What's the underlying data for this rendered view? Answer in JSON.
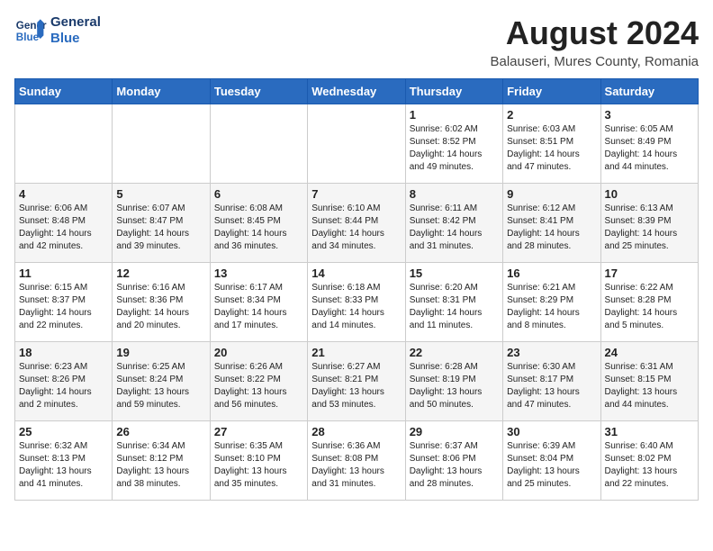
{
  "header": {
    "logo_line1": "General",
    "logo_line2": "Blue",
    "month_year": "August 2024",
    "location": "Balauseri, Mures County, Romania"
  },
  "weekdays": [
    "Sunday",
    "Monday",
    "Tuesday",
    "Wednesday",
    "Thursday",
    "Friday",
    "Saturday"
  ],
  "weeks": [
    [
      {
        "day": "",
        "info": ""
      },
      {
        "day": "",
        "info": ""
      },
      {
        "day": "",
        "info": ""
      },
      {
        "day": "",
        "info": ""
      },
      {
        "day": "1",
        "info": "Sunrise: 6:02 AM\nSunset: 8:52 PM\nDaylight: 14 hours\nand 49 minutes."
      },
      {
        "day": "2",
        "info": "Sunrise: 6:03 AM\nSunset: 8:51 PM\nDaylight: 14 hours\nand 47 minutes."
      },
      {
        "day": "3",
        "info": "Sunrise: 6:05 AM\nSunset: 8:49 PM\nDaylight: 14 hours\nand 44 minutes."
      }
    ],
    [
      {
        "day": "4",
        "info": "Sunrise: 6:06 AM\nSunset: 8:48 PM\nDaylight: 14 hours\nand 42 minutes."
      },
      {
        "day": "5",
        "info": "Sunrise: 6:07 AM\nSunset: 8:47 PM\nDaylight: 14 hours\nand 39 minutes."
      },
      {
        "day": "6",
        "info": "Sunrise: 6:08 AM\nSunset: 8:45 PM\nDaylight: 14 hours\nand 36 minutes."
      },
      {
        "day": "7",
        "info": "Sunrise: 6:10 AM\nSunset: 8:44 PM\nDaylight: 14 hours\nand 34 minutes."
      },
      {
        "day": "8",
        "info": "Sunrise: 6:11 AM\nSunset: 8:42 PM\nDaylight: 14 hours\nand 31 minutes."
      },
      {
        "day": "9",
        "info": "Sunrise: 6:12 AM\nSunset: 8:41 PM\nDaylight: 14 hours\nand 28 minutes."
      },
      {
        "day": "10",
        "info": "Sunrise: 6:13 AM\nSunset: 8:39 PM\nDaylight: 14 hours\nand 25 minutes."
      }
    ],
    [
      {
        "day": "11",
        "info": "Sunrise: 6:15 AM\nSunset: 8:37 PM\nDaylight: 14 hours\nand 22 minutes."
      },
      {
        "day": "12",
        "info": "Sunrise: 6:16 AM\nSunset: 8:36 PM\nDaylight: 14 hours\nand 20 minutes."
      },
      {
        "day": "13",
        "info": "Sunrise: 6:17 AM\nSunset: 8:34 PM\nDaylight: 14 hours\nand 17 minutes."
      },
      {
        "day": "14",
        "info": "Sunrise: 6:18 AM\nSunset: 8:33 PM\nDaylight: 14 hours\nand 14 minutes."
      },
      {
        "day": "15",
        "info": "Sunrise: 6:20 AM\nSunset: 8:31 PM\nDaylight: 14 hours\nand 11 minutes."
      },
      {
        "day": "16",
        "info": "Sunrise: 6:21 AM\nSunset: 8:29 PM\nDaylight: 14 hours\nand 8 minutes."
      },
      {
        "day": "17",
        "info": "Sunrise: 6:22 AM\nSunset: 8:28 PM\nDaylight: 14 hours\nand 5 minutes."
      }
    ],
    [
      {
        "day": "18",
        "info": "Sunrise: 6:23 AM\nSunset: 8:26 PM\nDaylight: 14 hours\nand 2 minutes."
      },
      {
        "day": "19",
        "info": "Sunrise: 6:25 AM\nSunset: 8:24 PM\nDaylight: 13 hours\nand 59 minutes."
      },
      {
        "day": "20",
        "info": "Sunrise: 6:26 AM\nSunset: 8:22 PM\nDaylight: 13 hours\nand 56 minutes."
      },
      {
        "day": "21",
        "info": "Sunrise: 6:27 AM\nSunset: 8:21 PM\nDaylight: 13 hours\nand 53 minutes."
      },
      {
        "day": "22",
        "info": "Sunrise: 6:28 AM\nSunset: 8:19 PM\nDaylight: 13 hours\nand 50 minutes."
      },
      {
        "day": "23",
        "info": "Sunrise: 6:30 AM\nSunset: 8:17 PM\nDaylight: 13 hours\nand 47 minutes."
      },
      {
        "day": "24",
        "info": "Sunrise: 6:31 AM\nSunset: 8:15 PM\nDaylight: 13 hours\nand 44 minutes."
      }
    ],
    [
      {
        "day": "25",
        "info": "Sunrise: 6:32 AM\nSunset: 8:13 PM\nDaylight: 13 hours\nand 41 minutes."
      },
      {
        "day": "26",
        "info": "Sunrise: 6:34 AM\nSunset: 8:12 PM\nDaylight: 13 hours\nand 38 minutes."
      },
      {
        "day": "27",
        "info": "Sunrise: 6:35 AM\nSunset: 8:10 PM\nDaylight: 13 hours\nand 35 minutes."
      },
      {
        "day": "28",
        "info": "Sunrise: 6:36 AM\nSunset: 8:08 PM\nDaylight: 13 hours\nand 31 minutes."
      },
      {
        "day": "29",
        "info": "Sunrise: 6:37 AM\nSunset: 8:06 PM\nDaylight: 13 hours\nand 28 minutes."
      },
      {
        "day": "30",
        "info": "Sunrise: 6:39 AM\nSunset: 8:04 PM\nDaylight: 13 hours\nand 25 minutes."
      },
      {
        "day": "31",
        "info": "Sunrise: 6:40 AM\nSunset: 8:02 PM\nDaylight: 13 hours\nand 22 minutes."
      }
    ]
  ]
}
